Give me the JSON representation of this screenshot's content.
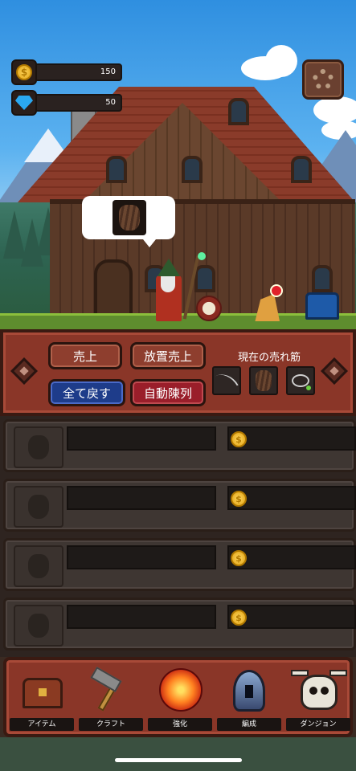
{
  "currency": {
    "gold": "150",
    "gems": "50"
  },
  "controls": {
    "sales_label": "売上",
    "idle_sales_label": "放置売上",
    "return_all_label": "全て戻す",
    "auto_display_label": "自動陳列",
    "trending_label": "現在の売れ筋",
    "trending_items": [
      "bow-icon",
      "shield-icon",
      "necklace-icon"
    ]
  },
  "shelves": [
    {
      "coin": "$"
    },
    {
      "coin": "$"
    },
    {
      "coin": "$"
    },
    {
      "coin": "$"
    }
  ],
  "nav": [
    {
      "label": "アイテム",
      "icon": "chest-icon"
    },
    {
      "label": "クラフト",
      "icon": "hammer-icon"
    },
    {
      "label": "強化",
      "icon": "fire-icon"
    },
    {
      "label": "編成",
      "icon": "helmet-icon"
    },
    {
      "label": "ダンジョン",
      "icon": "skull-icon"
    }
  ],
  "colors": {
    "panel": "#8a3628",
    "button_blue": "#1e3c8a",
    "button_crimson": "#9a1e2a",
    "gold": "#e0a010",
    "gem": "#2aa8f0"
  }
}
